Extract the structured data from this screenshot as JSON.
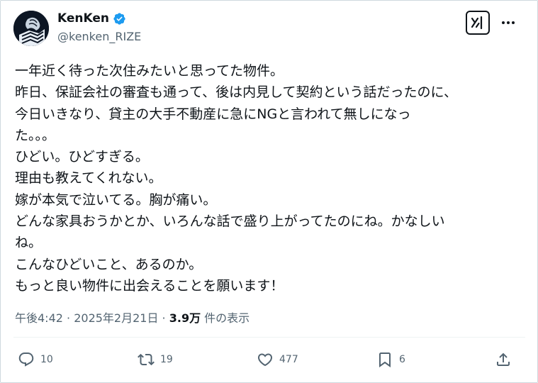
{
  "author": {
    "display_name": "KenKen",
    "handle": "@kenken_RIZE",
    "verified_icon": "verified-badge-icon"
  },
  "tweet": {
    "lines": [
      "一年近く待った次住みたいと思ってた物件。",
      "昨日、保証会社の審査も通って、後は内見して契約という話だったのに、",
      "今日いきなり、貸主の大手不動産に急にNGと言われて無しになっ",
      "た。。。",
      "ひどい。ひどすぎる。",
      "理由も教えてくれない。",
      "嫁が本気で泣いてる。胸が痛い。",
      "どんな家具おうかとか、いろんな話で盛り上がってたのにね。かなしい",
      "ね。",
      "こんなひどいこと、あるのか。",
      "もっと良い物件に出会えることを願います！"
    ]
  },
  "meta": {
    "time": "午後4:42",
    "separator": " · ",
    "date": "2025年2月21日",
    "views_count": "3.9万",
    "views_label": " 件の表示"
  },
  "actions": {
    "reply_count": "10",
    "retweet_count": "19",
    "like_count": "477",
    "bookmark_count": "6"
  },
  "colors": {
    "text": "#0f1419",
    "secondary": "#536471",
    "verified": "#1d9bf0",
    "border": "#cfd9de"
  }
}
